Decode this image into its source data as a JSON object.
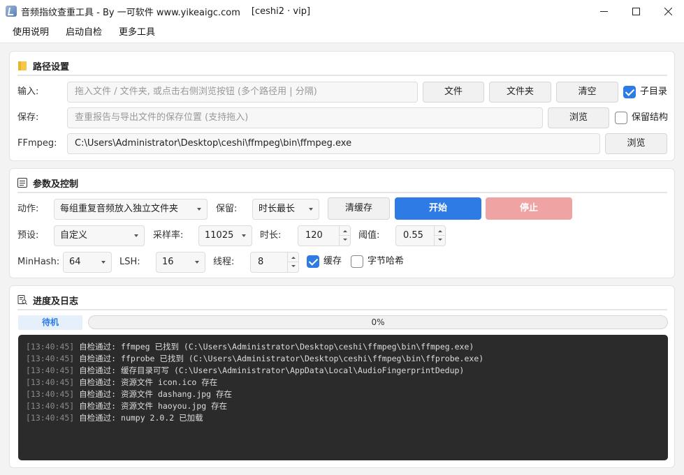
{
  "window": {
    "title": "音频指纹查重工具 - By 一可软件 www.yikeaigc.com",
    "subtitle": "[ceshi2 · vip]"
  },
  "menu": [
    "使用说明",
    "启动自检",
    "更多工具"
  ],
  "path_settings": {
    "heading": "路径设置",
    "input_label": "输入:",
    "input_placeholder": "拖入文件 / 文件夹, 或点击右侧浏览按钮 (多个路径用 | 分隔)",
    "file_button": "文件",
    "folder_button": "文件夹",
    "clear_button": "清空",
    "subdir_label": "子目录",
    "subdir_checked": true,
    "save_label": "保存:",
    "save_placeholder": "查重报告与导出文件的保存位置 (支持拖入)",
    "save_browse_button": "浏览",
    "keep_structure_label": "保留结构",
    "keep_structure_checked": false,
    "ffmpeg_label": "FFmpeg:",
    "ffmpeg_value": "C:\\Users\\Administrator\\Desktop\\ceshi\\ffmpeg\\bin\\ffmpeg.exe",
    "ffmpeg_browse_button": "浏览"
  },
  "params": {
    "heading": "参数及控制",
    "action_label": "动作:",
    "action_value": "每组重复音频放入独立文件夹",
    "keep_label": "保留:",
    "keep_value": "时长最长",
    "clear_cache_button": "清缓存",
    "start_button": "开始",
    "stop_button": "停止",
    "preset_label": "预设:",
    "preset_value": "自定义",
    "sample_rate_label": "采样率:",
    "sample_rate_value": "11025",
    "duration_label": "时长:",
    "duration_value": "120",
    "threshold_label": "阈值:",
    "threshold_value": "0.55",
    "minhash_label": "MinHash:",
    "minhash_value": "64",
    "lsh_label": "LSH:",
    "lsh_value": "16",
    "threads_label": "线程:",
    "threads_value": "8",
    "cache_label": "缓存",
    "cache_checked": true,
    "byte_hash_label": "字节哈希",
    "byte_hash_checked": false
  },
  "progress": {
    "heading": "进度及日志",
    "status": "待机",
    "percent_text": "0%",
    "fraction": 0
  },
  "log": [
    {
      "time": "[13:40:45]",
      "text": "自检通过: ffmpeg 已找到 (C:\\Users\\Administrator\\Desktop\\ceshi\\ffmpeg\\bin\\ffmpeg.exe)"
    },
    {
      "time": "[13:40:45]",
      "text": "自检通过: ffprobe 已找到 (C:\\Users\\Administrator\\Desktop\\ceshi\\ffmpeg\\bin\\ffprobe.exe)"
    },
    {
      "time": "[13:40:45]",
      "text": "自检通过: 缓存目录可写 (C:\\Users\\Administrator\\AppData\\Local\\AudioFingerprintDedup)"
    },
    {
      "time": "[13:40:45]",
      "text": "自检通过: 资源文件 icon.ico 存在"
    },
    {
      "time": "[13:40:45]",
      "text": "自检通过: 资源文件 dashang.jpg 存在"
    },
    {
      "time": "[13:40:45]",
      "text": "自检通过: 资源文件 haoyou.jpg 存在"
    },
    {
      "time": "[13:40:45]",
      "text": "自检通过: numpy 2.0.2 已加载"
    }
  ],
  "colors": {
    "accent": "#2e7be6",
    "stop": "#efa3a3",
    "log_bg": "#2b2b2b"
  }
}
